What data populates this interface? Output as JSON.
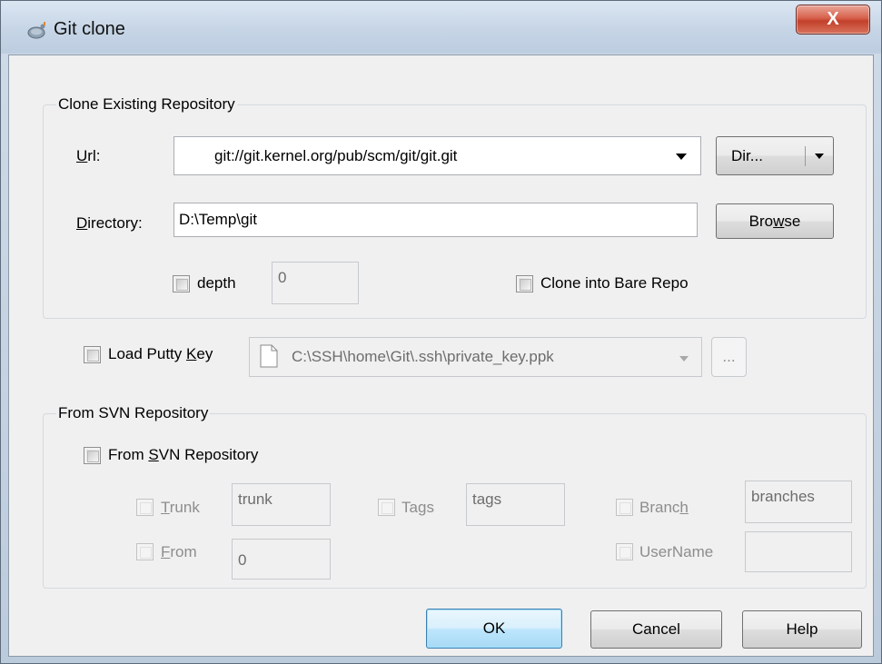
{
  "window": {
    "title": "Git clone",
    "close_label": "X"
  },
  "clone": {
    "group_label": "Clone Existing Repository",
    "url_label_u": "U",
    "url_label_rest": "rl:",
    "url_value": "git://git.kernel.org/pub/scm/git/git.git",
    "dir_button": "Dir...",
    "directory_label_u": "D",
    "directory_label_rest": "irectory:",
    "directory_value": "D:\\Temp\\git",
    "browse_pre": "Bro",
    "browse_u": "w",
    "browse_post": "se",
    "depth_label": "depth",
    "depth_value": "0",
    "bare_label": "Clone into Bare Repo"
  },
  "putty": {
    "label_pre": "Load Putty ",
    "label_u": "K",
    "label_post": "ey",
    "key_path": "C:\\SSH\\home\\Git\\.ssh\\private_key.ppk",
    "browse_label": "..."
  },
  "svn": {
    "group_label": "From SVN Repository",
    "from_svn_pre": "From ",
    "from_svn_u": "S",
    "from_svn_post": "VN Repository",
    "trunk_u": "T",
    "trunk_rest": "runk",
    "trunk_value": "trunk",
    "tags_pre": "Ta",
    "tags_u": "g",
    "tags_post": "s",
    "tags_value": "tags",
    "branch_pre": "Branc",
    "branch_u": "h",
    "branch_value": "branches",
    "from_u": "F",
    "from_rest": "rom",
    "from_value": "0",
    "username_label": "UserName",
    "username_value": ""
  },
  "buttons": {
    "ok": "OK",
    "cancel": "Cancel",
    "help": "Help"
  },
  "colors": {
    "title_bar": "#c6d5e6",
    "close_button": "#c2402b",
    "default_button": "#bee6fd"
  }
}
